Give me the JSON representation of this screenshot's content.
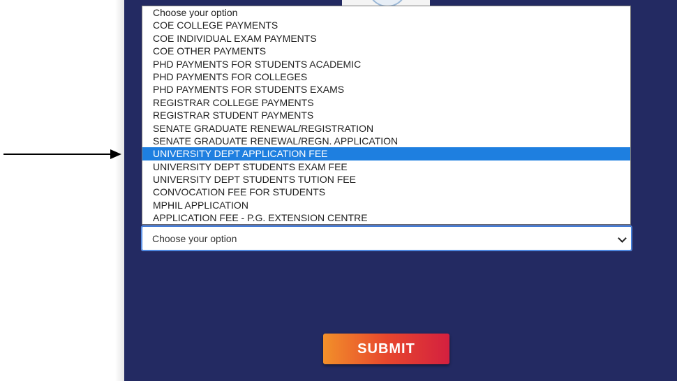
{
  "dropdown": {
    "options": [
      "Choose your option",
      "COE COLLEGE PAYMENTS",
      "COE INDIVIDUAL EXAM PAYMENTS",
      "COE OTHER PAYMENTS",
      "PHD PAYMENTS FOR STUDENTS ACADEMIC",
      "PHD PAYMENTS FOR COLLEGES",
      "PHD PAYMENTS FOR STUDENTS EXAMS",
      "REGISTRAR COLLEGE PAYMENTS",
      "REGISTRAR STUDENT PAYMENTS",
      "SENATE GRADUATE RENEWAL/REGISTRATION",
      "SENATE GRADUATE RENEWAL/REGN. APPLICATION",
      "UNIVERSITY DEPT APPLICATION FEE",
      "UNIVERSITY DEPT STUDENTS EXAM FEE",
      "UNIVERSITY DEPT STUDENTS TUTION FEE",
      "CONVOCATION FEE FOR STUDENTS",
      "MPHIL APPLICATION",
      "APPLICATION FEE - P.G. EXTENSION CENTRE"
    ],
    "highlighted_option": "UNIVERSITY DEPT APPLICATION FEE"
  },
  "select": {
    "value": "Choose your option"
  },
  "form": {
    "submit_label": "SUBMIT"
  },
  "colors": {
    "panel_bg": "#232a62",
    "highlight": "#1e7fe0",
    "submit_gradient_start": "#f2902a",
    "submit_gradient_end": "#d4203f"
  },
  "icons": {
    "annotation_arrow": "right-arrow-icon",
    "select_chevron": "chevron-down-icon"
  }
}
